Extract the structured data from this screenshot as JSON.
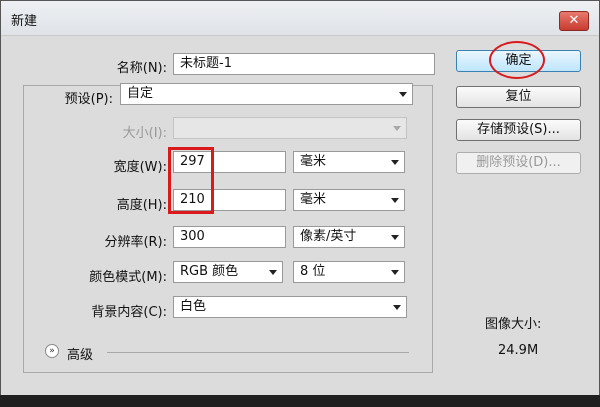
{
  "dialog": {
    "title": "新建",
    "close_glyph": "✕"
  },
  "form": {
    "name_label": "名称(N):",
    "name_value": "未标题-1",
    "preset_label": "预设(P):",
    "preset_value": "自定",
    "size_label": "大小(I):",
    "size_value": "",
    "width_label": "宽度(W):",
    "width_value": "297",
    "width_unit": "毫米",
    "height_label": "高度(H):",
    "height_value": "210",
    "height_unit": "毫米",
    "resolution_label": "分辨率(R):",
    "resolution_value": "300",
    "resolution_unit": "像素/英寸",
    "color_mode_label": "颜色模式(M):",
    "color_mode_value": "RGB 颜色",
    "bit_depth": "8 位",
    "background_label": "背景内容(C):",
    "background_value": "白色",
    "advanced_label": "高级"
  },
  "buttons": {
    "ok": "确定",
    "reset": "复位",
    "save_preset": "存储预设(S)...",
    "delete_preset": "删除预设(D)..."
  },
  "image_info": {
    "label": "图像大小:",
    "value": "24.9M"
  },
  "colors": {
    "highlight_red": "#d9191a",
    "dialog_bg": "#dcdcdc",
    "primary_button": "#bee6fd"
  },
  "icons": [
    "close-icon",
    "dropdown-arrow-icon",
    "advanced-expand-icon"
  ]
}
